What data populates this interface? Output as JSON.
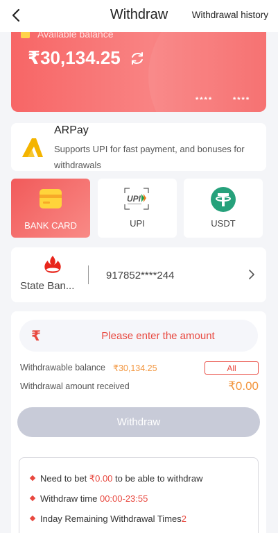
{
  "header": {
    "title": "Withdraw",
    "history_label": "Withdrawal history"
  },
  "balance_card": {
    "label": "Available balance",
    "amount": "₹30,134.25",
    "mask_left": "****",
    "mask_right": "****"
  },
  "arpay": {
    "name": "ARPay",
    "description": "Supports UPI for fast payment, and bonuses for withdrawals"
  },
  "methods": [
    {
      "label": "BANK CARD",
      "icon": "bank-card-icon",
      "active": true
    },
    {
      "label": "UPI",
      "icon": "upi-logo-icon",
      "active": false
    },
    {
      "label": "USDT",
      "icon": "tether-icon",
      "active": false
    }
  ],
  "account": {
    "bank_name": "State Ban...",
    "number": "917852****244"
  },
  "amount_form": {
    "currency_symbol": "₹",
    "placeholder": "Please enter the amount",
    "withdrawable_label": "Withdrawable balance",
    "withdrawable_value": "₹30,134.25",
    "all_label": "All",
    "received_label": "Withdrawal amount received",
    "received_value": "₹0.00",
    "withdraw_button": "Withdraw"
  },
  "rules": [
    {
      "prefix": "Need to bet ",
      "highlight": "₹0.00",
      "suffix": " to be able to withdraw"
    },
    {
      "prefix": "Withdraw time ",
      "highlight": "00:00-23:55",
      "suffix": ""
    },
    {
      "prefix": "Inday Remaining Withdrawal Times",
      "highlight": "2",
      "suffix": ""
    }
  ],
  "colors": {
    "accent": "#e8483f",
    "orange": "#f2953d",
    "card_gradient_start": "#f76666",
    "card_gradient_end": "#f98383",
    "disabled_button": "#c8cbd8"
  }
}
